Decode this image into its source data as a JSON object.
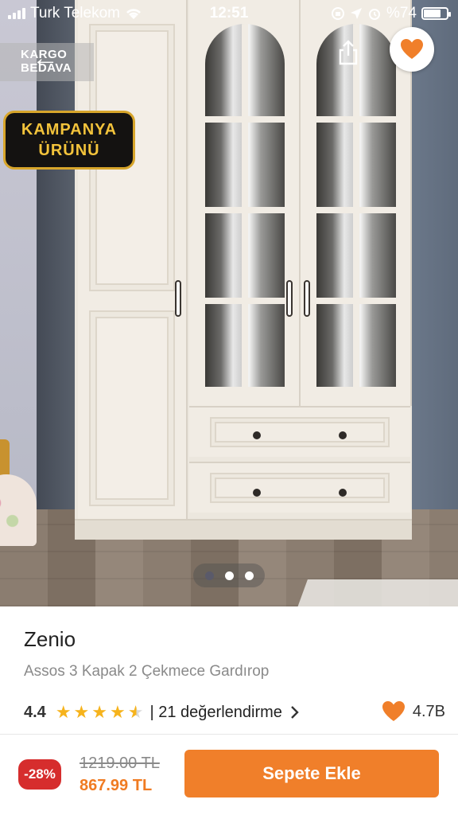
{
  "status_bar": {
    "carrier": "Turk Telekom",
    "time": "12:51",
    "battery": "%74"
  },
  "hero": {
    "badge_lines": [
      "KARGO",
      "BEDAVA"
    ],
    "campaign_lines": [
      "KAMPANYA",
      "ÜRÜNÜ"
    ],
    "gallery": {
      "count": 3,
      "active_index": 0
    }
  },
  "product": {
    "brand": "Zenio",
    "name": "Assos 3 Kapak 2 Çekmece Gardırop",
    "rating": "4.4",
    "stars": 4.4,
    "reviews_label": "| 21 değerlendirme",
    "likes": "4.7B"
  },
  "pricing": {
    "discount": "-28%",
    "old_price": "1219.00 TL",
    "new_price": "867.99 TL",
    "cta_label": "Sepete Ekle"
  },
  "colors": {
    "accent": "#f07f2a",
    "discount_red": "#d62d2d",
    "star": "#f6b31c",
    "campaign_gold": "#d7a52b"
  },
  "icons": {
    "back": "arrow-left-icon",
    "share": "share-icon",
    "favorite": "heart-icon",
    "review_chevron": "chevron-right-icon",
    "likes": "heart-icon"
  }
}
